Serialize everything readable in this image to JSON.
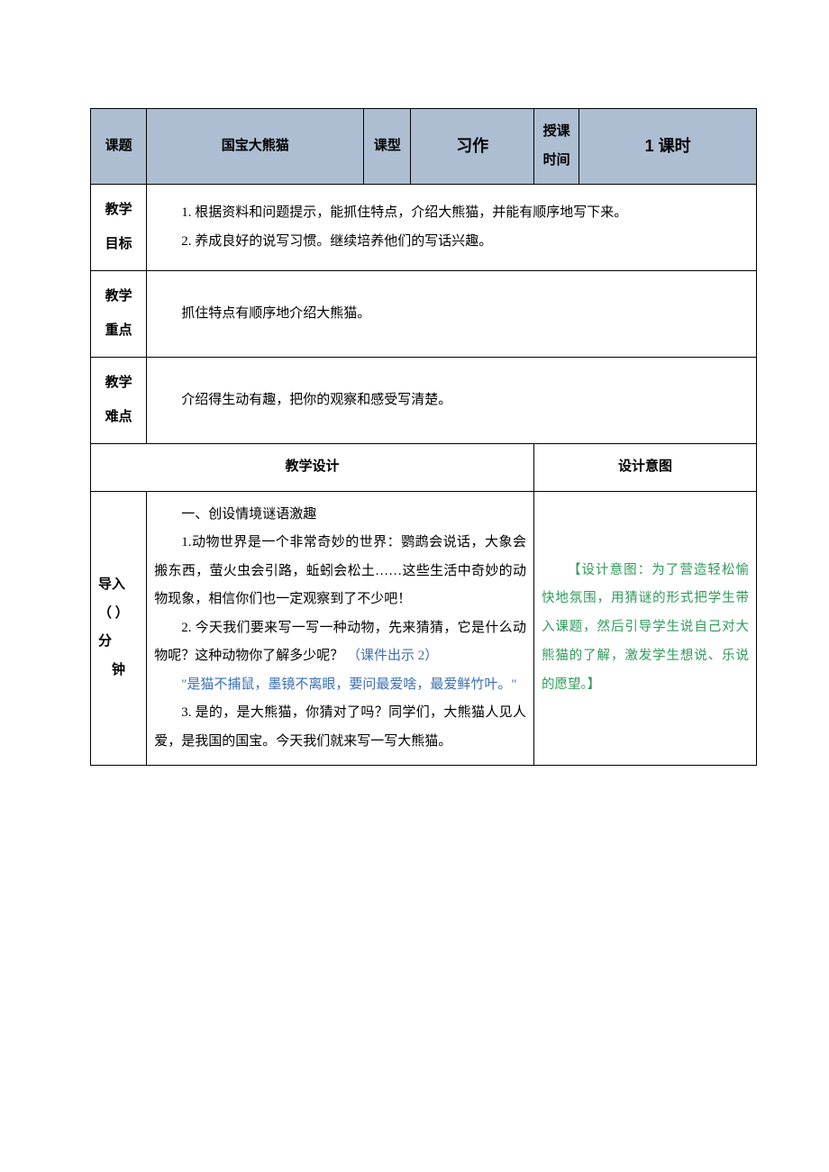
{
  "header": {
    "topic_label": "课题",
    "topic_value": "国宝大熊猫",
    "type_label": "课型",
    "type_value": "习作",
    "time_label_1": "授课",
    "time_label_2": "时间",
    "time_value": "1 课时"
  },
  "goals": {
    "label": "教学目标",
    "line1": "1. 根据资料和问题提示，能抓住特点，介绍大熊猫，并能有顺序地写下来。",
    "line2": "2. 养成良好的说写习惯。继续培养他们的写话兴趣。"
  },
  "focus": {
    "label": "教学重点",
    "text": "抓住特点有顺序地介绍大熊猫。"
  },
  "difficulty": {
    "label": "教学难点",
    "text": "介绍得生动有趣，把你的观察和感受写清楚。"
  },
  "section_headers": {
    "design": "教学设计",
    "intent": "设计意图"
  },
  "stage": {
    "label_l1": "导入",
    "label_l2": "（  ）分",
    "label_l3": "钟"
  },
  "body": {
    "h": "一、创设情境谜语激趣",
    "p1": "1.动物世界是一个非常奇妙的世界：鹦鹉会说话，大象会搬东西，萤火虫会引路，蚯蚓会松土……这些生活中奇妙的动物现象，相信你们也一定观察到了不少吧！",
    "p2a": "2. 今天我们要来写一写一种动物，先来猜猜，它是什么动物呢？这种动物你了解多少呢？",
    "p2b": "（课件出示 2）",
    "quote": "\"是猫不捕鼠，墨镜不离眼，要问最爱啥，最爱鲜竹叶。\"",
    "p3": "3. 是的，是大熊猫，你猜对了吗？同学们，大熊猫人见人爱，是我国的国宝。今天我们就来写一写大熊猫。"
  },
  "intent": {
    "text": "【设计意图：为了营造轻松愉快地氛围，用猜谜的形式把学生带入课题，然后引导学生说自己对大熊猫的了解，激发学生想说、乐说的愿望。】"
  }
}
